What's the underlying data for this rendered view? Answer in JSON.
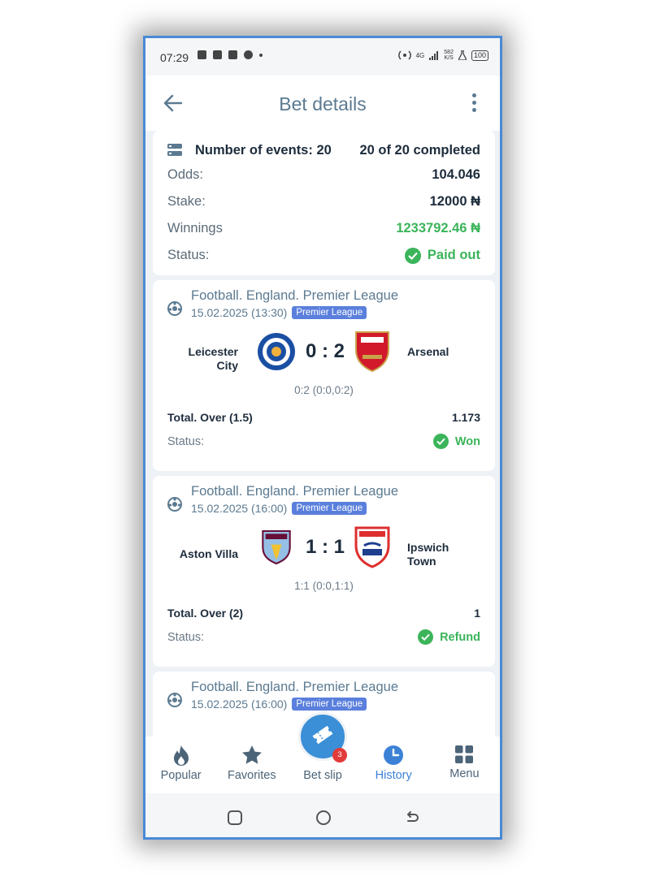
{
  "statusbar": {
    "time": "07:29",
    "network": "4G",
    "speed": "582\nK/S",
    "battery": "100"
  },
  "header": {
    "title": "Bet details"
  },
  "summary": {
    "events_label": "Number of events: 20",
    "completed": "20 of 20 completed",
    "rows": [
      {
        "label": "Odds:",
        "value": "104.046"
      },
      {
        "label": "Stake:",
        "value": "12000 ₦"
      },
      {
        "label": "Winnings",
        "value": "1233792.46 ₦"
      },
      {
        "label": "Status:",
        "value": "Paid out"
      }
    ]
  },
  "events": [
    {
      "league": "Football. England. Premier League",
      "date": "15.02.2025 (13:30)",
      "badge": "Premier League",
      "home": "Leicester City",
      "away": "Arsenal",
      "score": "0 : 2",
      "subscore": "0:2 (0:0,0:2)",
      "bet": "Total. Over (1.5)",
      "odds": "1.173",
      "status_label": "Status:",
      "status": "Won",
      "home_crest": "Leicester City crest",
      "away_crest": "Arsenal crest"
    },
    {
      "league": "Football. England. Premier League",
      "date": "15.02.2025 (16:00)",
      "badge": "Premier League",
      "home": "Aston Villa",
      "away": "Ipswich Town",
      "score": "1 : 1",
      "subscore": "1:1 (0:0,1:1)",
      "bet": "Total. Over (2)",
      "odds": "1",
      "status_label": "Status:",
      "status": "Refund"
    },
    {
      "league": "Football. England. Premier League",
      "date": "15.02.2025 (16:00)",
      "badge": "Premier League"
    }
  ],
  "nav": {
    "items": [
      {
        "label": "Popular",
        "icon": "fire-icon"
      },
      {
        "label": "Favorites",
        "icon": "star-icon"
      },
      {
        "label": "Bet slip",
        "icon": "ticket-icon",
        "count": "3"
      },
      {
        "label": "History",
        "icon": "clock-icon"
      },
      {
        "label": "Menu",
        "icon": "grid-icon"
      }
    ]
  },
  "colors": {
    "accent": "#3b8fd6",
    "success": "#3bb45a",
    "badge": "#5a7fdc",
    "frame": "#4a8ad6"
  }
}
